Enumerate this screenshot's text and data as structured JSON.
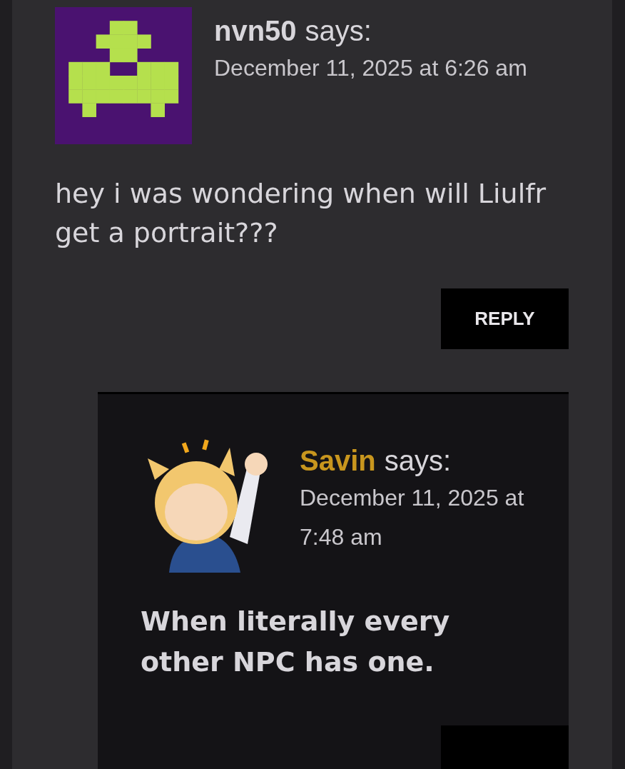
{
  "comment": {
    "author": "nvn50",
    "says": "says:",
    "date": "December 11, 2025 at 6:26 am",
    "text": "hey i was wondering when will Liulfr get a portrait???",
    "reply_label": "REPLY",
    "is_author": false,
    "replies": [
      {
        "author": "Savin",
        "says": "says:",
        "date": "December 11, 2025 at 7:48 am",
        "text": "When literally every other NPC has one.",
        "is_author": true
      }
    ]
  }
}
